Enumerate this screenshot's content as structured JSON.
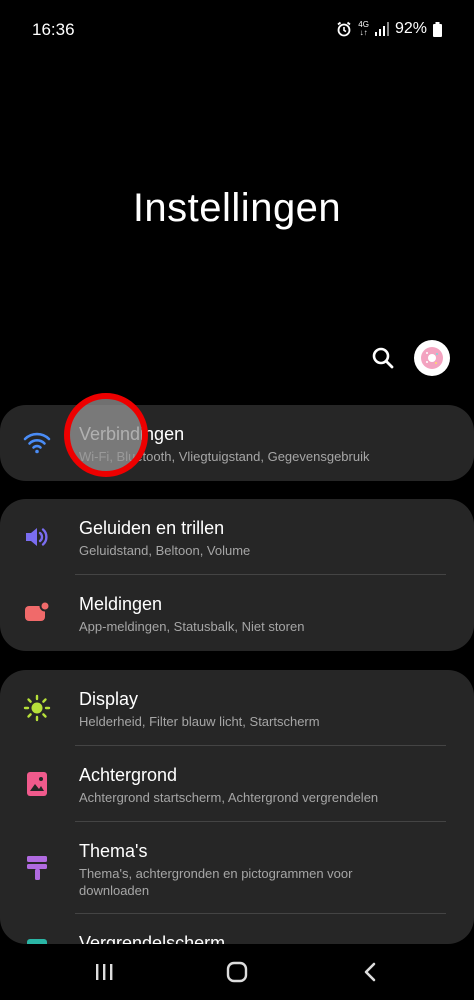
{
  "status_bar": {
    "time": "16:36",
    "network_top": "4G",
    "network_bottom": "↓↑",
    "battery": "92%",
    "icons": [
      "alarm-icon",
      "network-4g-icon",
      "signal-icon",
      "battery-icon"
    ]
  },
  "page_title": "Instellingen",
  "toolbar": {
    "search_icon": "search-icon",
    "avatar_icon": "donut-avatar"
  },
  "sections": [
    {
      "items": [
        {
          "icon": "wifi-icon",
          "icon_color": "#4a8cf5",
          "label": "Verbindingen",
          "subtitle": "Wi-Fi, Bluetooth, Vliegtuigstand, Gegevensgebruik"
        }
      ]
    },
    {
      "items": [
        {
          "icon": "volume-icon",
          "icon_color": "#7a6df0",
          "label": "Geluiden en trillen",
          "subtitle": "Geluidstand, Beltoon, Volume"
        },
        {
          "icon": "notification-icon",
          "icon_color": "#f06a6a",
          "label": "Meldingen",
          "subtitle": "App-meldingen, Statusbalk, Niet storen"
        }
      ]
    },
    {
      "items": [
        {
          "icon": "brightness-icon",
          "icon_color": "#b6e03a",
          "label": "Display",
          "subtitle": "Helderheid, Filter blauw licht, Startscherm"
        },
        {
          "icon": "wallpaper-icon",
          "icon_color": "#f05a8c",
          "label": "Achtergrond",
          "subtitle": "Achtergrond startscherm, Achtergrond vergrendelen"
        },
        {
          "icon": "theme-icon",
          "icon_color": "#b06ae0",
          "label": "Thema's",
          "subtitle": "Thema's, achtergronden en pictogrammen voor downloaden"
        },
        {
          "icon": "lock-screen-icon",
          "icon_color": "#2ab5a5",
          "label": "Vergrendelscherm",
          "subtitle": ""
        }
      ]
    }
  ],
  "nav_bar": {
    "recents_icon": "recents-icon",
    "home_icon": "home-icon",
    "back_icon": "back-icon"
  }
}
